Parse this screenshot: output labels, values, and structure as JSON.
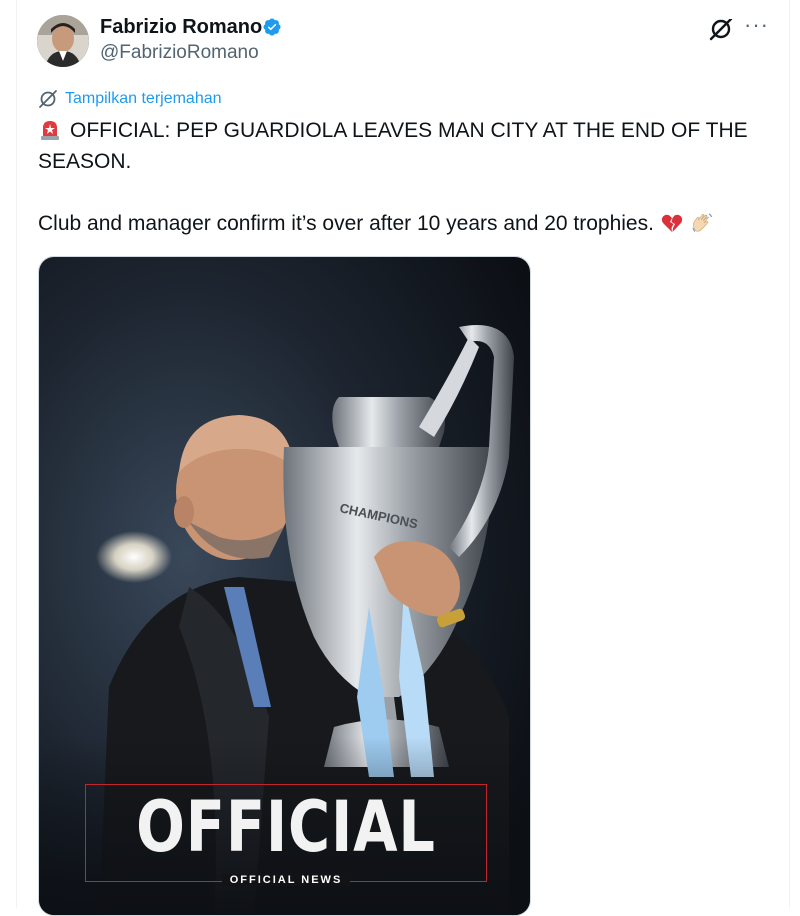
{
  "author": {
    "name": "Fabrizio Romano",
    "handle": "@FabrizioRomano"
  },
  "icons": {
    "verified": "verified-badge-icon",
    "grok": "grok-icon",
    "more": "more-options-icon",
    "translate": "translate-icon",
    "siren": "rotating-light-emoji",
    "broken_heart": "broken-heart-emoji",
    "waving_hand": "waving-hand-emoji"
  },
  "translate_label": "Tampilkan terjemahan",
  "tweet": {
    "line1": "OFFICIAL: PEP GUARDIOLA LEAVES MAN CITY AT THE END OF THE SEASON.",
    "line2": "Club and manager confirm it’s over after 10 years and 20 trophies."
  },
  "media": {
    "headline": "OFFICIAL",
    "subline": "OFFICIAL NEWS",
    "trophy_text": "CHAMPIONS"
  },
  "colors": {
    "accent": "#1d9bf0",
    "secondary_text": "#536471",
    "frame_red": "#c0262b"
  }
}
